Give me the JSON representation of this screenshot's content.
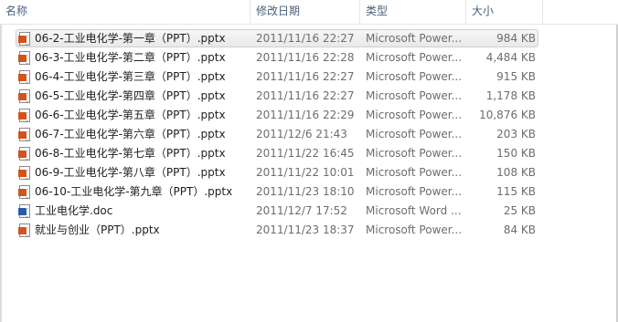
{
  "columns": {
    "name": "名称",
    "date": "修改日期",
    "type": "类型",
    "size": "大小"
  },
  "files": [
    {
      "name": "06-2-工业电化学-第一章（PPT）.pptx",
      "date": "2011/11/16 22:27",
      "type": "Microsoft Power...",
      "size": "984 KB",
      "icon": "powerpoint-file-icon",
      "selected": true
    },
    {
      "name": "06-3-工业电化学-第二章（PPT）.pptx",
      "date": "2011/11/16 22:28",
      "type": "Microsoft Power...",
      "size": "4,484 KB",
      "icon": "powerpoint-file-icon"
    },
    {
      "name": "06-4-工业电化学-第三章（PPT）.pptx",
      "date": "2011/11/16 22:27",
      "type": "Microsoft Power...",
      "size": "915 KB",
      "icon": "powerpoint-file-icon"
    },
    {
      "name": "06-5-工业电化学-第四章（PPT）.pptx",
      "date": "2011/11/16 22:27",
      "type": "Microsoft Power...",
      "size": "1,178 KB",
      "icon": "powerpoint-file-icon"
    },
    {
      "name": "06-6-工业电化学-第五章（PPT）.pptx",
      "date": "2011/11/16 22:29",
      "type": "Microsoft Power...",
      "size": "10,876 KB",
      "icon": "powerpoint-file-icon"
    },
    {
      "name": "06-7-工业电化学-第六章（PPT）.pptx",
      "date": "2011/12/6 21:43",
      "type": "Microsoft Power...",
      "size": "203 KB",
      "icon": "powerpoint-file-icon"
    },
    {
      "name": "06-8-工业电化学-第七章（PPT）.pptx",
      "date": "2011/11/22 16:45",
      "type": "Microsoft Power...",
      "size": "150 KB",
      "icon": "powerpoint-file-icon"
    },
    {
      "name": "06-9-工业电化学-第八章（PPT）.pptx",
      "date": "2011/11/22 10:01",
      "type": "Microsoft Power...",
      "size": "108 KB",
      "icon": "powerpoint-file-icon"
    },
    {
      "name": "06-10-工业电化学-第九章（PPT）.pptx",
      "date": "2011/11/23 18:10",
      "type": "Microsoft Power...",
      "size": "115 KB",
      "icon": "powerpoint-file-icon"
    },
    {
      "name": "工业电化学.doc",
      "date": "2011/12/7 17:52",
      "type": "Microsoft Word ...",
      "size": "25 KB",
      "icon": "word-file-icon"
    },
    {
      "name": "就业与创业（PPT）.pptx",
      "date": "2011/11/23 18:37",
      "type": "Microsoft Power...",
      "size": "84 KB",
      "icon": "powerpoint-file-icon"
    }
  ]
}
